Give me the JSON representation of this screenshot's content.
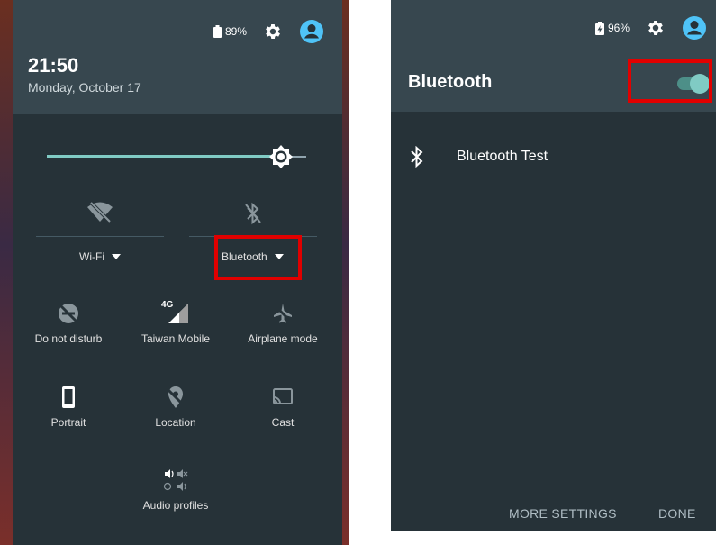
{
  "left": {
    "battery": "89%",
    "time": "21:50",
    "date": "Monday, October 17",
    "brightness_level": 0.9,
    "wifi_label": "Wi-Fi",
    "bluetooth_label": "Bluetooth",
    "tiles": {
      "dnd": "Do not disturb",
      "mobile": "Taiwan Mobile",
      "mobile_badge": "4G",
      "airplane": "Airplane mode",
      "portrait": "Portrait",
      "location": "Location",
      "cast": "Cast",
      "audio": "Audio profiles"
    }
  },
  "right": {
    "battery": "96%",
    "title": "Bluetooth",
    "toggle_on": true,
    "device": "Bluetooth Test",
    "more_settings": "MORE SETTINGS",
    "done": "DONE"
  },
  "colors": {
    "accent": "#80cbc4",
    "highlight": "#e10000",
    "panel": "#263238",
    "header": "#37474f"
  }
}
